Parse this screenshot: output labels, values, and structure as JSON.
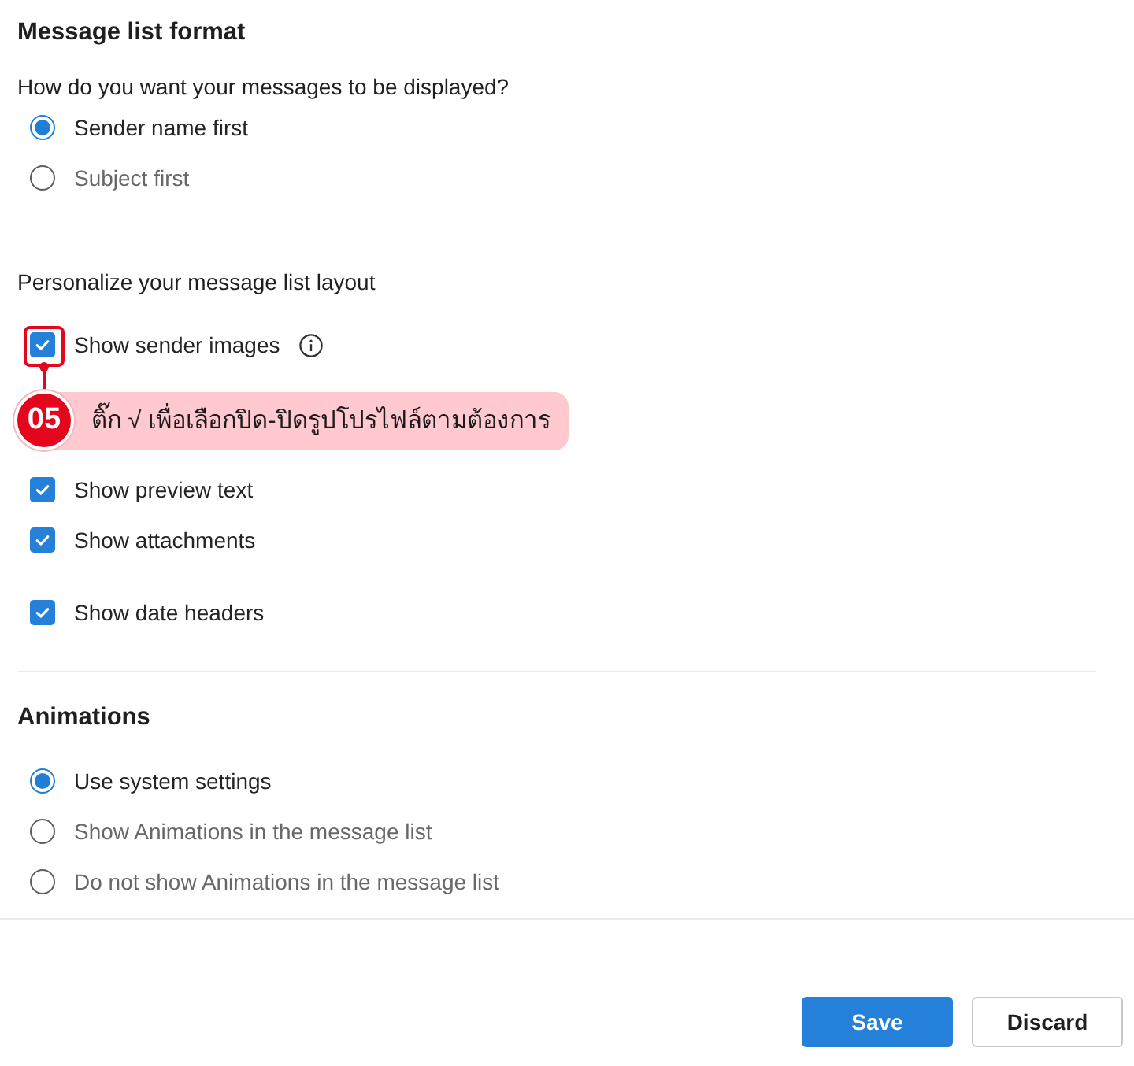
{
  "message_list_format": {
    "title": "Message list format",
    "question": "How do you want your messages to be displayed?",
    "options": [
      {
        "label": "Sender name first",
        "selected": true
      },
      {
        "label": "Subject first",
        "selected": false
      }
    ]
  },
  "layout": {
    "title": "Personalize your message list layout",
    "options": [
      {
        "label": "Show sender images",
        "checked": true,
        "info": true
      },
      {
        "label": "Show preview text",
        "checked": true,
        "info": false
      },
      {
        "label": "Show attachments",
        "checked": true,
        "info": false
      },
      {
        "label": "Show date headers",
        "checked": true,
        "info": false
      }
    ]
  },
  "annotation": {
    "number": "05",
    "text": "ติ๊ก √ เพื่อเลือกปิด-ปิดรูปโปรไฟล์ตามต้องการ"
  },
  "animations": {
    "title": "Animations",
    "options": [
      {
        "label": "Use system settings",
        "selected": true
      },
      {
        "label": "Show Animations in the message list",
        "selected": false
      },
      {
        "label": "Do not show Animations in the message list",
        "selected": false
      }
    ]
  },
  "buttons": [
    {
      "label": "Save",
      "kind": "primary"
    },
    {
      "label": "Discard",
      "kind": "secondary"
    }
  ]
}
